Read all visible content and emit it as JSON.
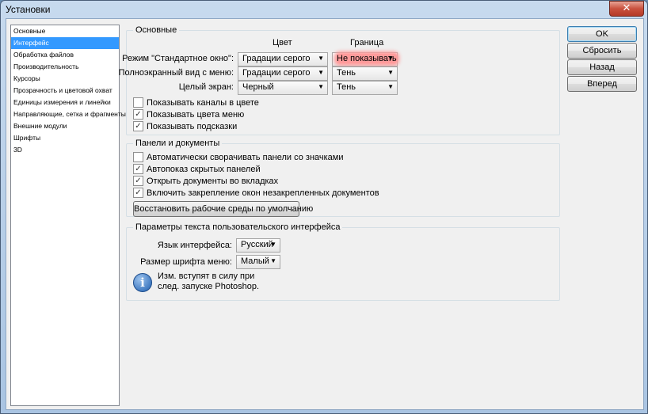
{
  "window": {
    "title": "Установки",
    "close_glyph": "✕"
  },
  "sidebar": {
    "items": [
      {
        "label": "Основные",
        "selected": false
      },
      {
        "label": "Интерфейс",
        "selected": true
      },
      {
        "label": "Обработка файлов",
        "selected": false
      },
      {
        "label": "Производительность",
        "selected": false
      },
      {
        "label": "Курсоры",
        "selected": false
      },
      {
        "label": "Прозрачность и цветовой охват",
        "selected": false
      },
      {
        "label": "Единицы измерения и линейки",
        "selected": false
      },
      {
        "label": "Направляющие, сетка и фрагменты",
        "selected": false
      },
      {
        "label": "Внешние модули",
        "selected": false
      },
      {
        "label": "Шрифты",
        "selected": false
      },
      {
        "label": "3D",
        "selected": false
      }
    ]
  },
  "general": {
    "legend": "Основные",
    "col_color": "Цвет",
    "col_border": "Граница",
    "rows": [
      {
        "label": "Режим \"Стандартное окно\":",
        "color": "Градации серого",
        "border": "Не показывать"
      },
      {
        "label": "Полноэкранный вид с меню:",
        "color": "Градации серого",
        "border": "Тень"
      },
      {
        "label": "Целый экран:",
        "color": "Черный",
        "border": "Тень"
      }
    ],
    "checks": [
      {
        "label": "Показывать каналы в цвете",
        "checked": false
      },
      {
        "label": "Показывать цвета меню",
        "checked": true
      },
      {
        "label": "Показывать подсказки",
        "checked": true
      }
    ]
  },
  "panels": {
    "legend": "Панели и документы",
    "checks": [
      {
        "label": "Автоматически сворачивать панели со значками",
        "checked": false
      },
      {
        "label": "Автопоказ скрытых панелей",
        "checked": true
      },
      {
        "label": "Открыть документы во вкладках",
        "checked": true
      },
      {
        "label": "Включить закрепление окон незакрепленных документов",
        "checked": true
      }
    ],
    "restore_button": "Восстановить рабочие среды по умолчанию"
  },
  "ui_text": {
    "legend": "Параметры текста пользовательского интерфейса",
    "language_label": "Язык интерфейса:",
    "language_value": "Русский",
    "font_size_label": "Размер шрифта меню:",
    "font_size_value": "Малый",
    "info_glyph": "i",
    "note_line1": "Изм. вступят в силу при",
    "note_line2": "след. запуске Photoshop."
  },
  "buttons": {
    "ok": "OK",
    "reset": "Сбросить",
    "back": "Назад",
    "forward": "Вперед"
  },
  "glyphs": {
    "check": "✓",
    "dropdown": "▼"
  },
  "colors": {
    "selection": "#3399ff",
    "highlight": "#ff9b9b"
  }
}
